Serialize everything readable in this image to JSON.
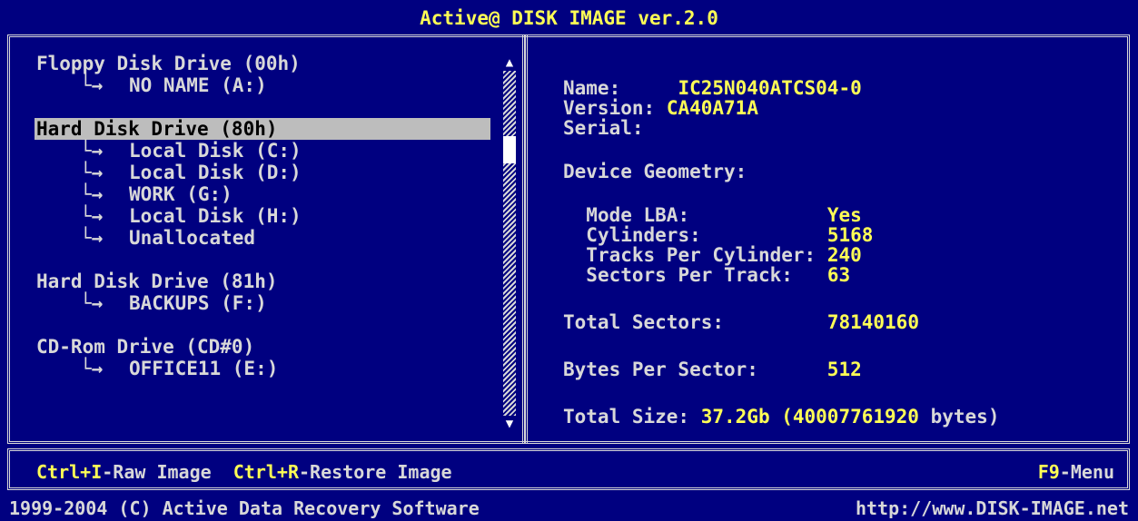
{
  "title": "Active@ DISK IMAGE ver.2.0",
  "tree": {
    "floppy": {
      "label": "Floppy Disk Drive (00h)",
      "children": [
        "NO NAME (A:)"
      ]
    },
    "hdd0": {
      "label": "Hard Disk Drive (80h)",
      "children": [
        "Local Disk (C:)",
        "Local Disk (D:)",
        "WORK (G:)",
        "Local Disk (H:)",
        "Unallocated"
      ]
    },
    "hdd1": {
      "label": "Hard Disk Drive (81h)",
      "children": [
        "BACKUPS (F:)"
      ]
    },
    "cdrom": {
      "label": "CD-Rom Drive (CD#0)",
      "children": [
        "OFFICE11 (E:)"
      ]
    }
  },
  "details": {
    "name_label": "Name:",
    "name_value": "IC25N040ATCS04-0",
    "version_label": "Version:",
    "version_value": "CA40A71A",
    "serial_label": "Serial:",
    "geometry_label": "Device Geometry:",
    "mode_label": "Mode LBA:",
    "mode_value": "Yes",
    "cyl_label": "Cylinders:",
    "cyl_value": "5168",
    "tpc_label": "Tracks Per Cylinder:",
    "tpc_value": "240",
    "spt_label": "Sectors Per Track:",
    "spt_value": "63",
    "total_sectors_label": "Total Sectors:",
    "total_sectors_value": "78140160",
    "bps_label": "Bytes Per Sector:",
    "bps_value": "512",
    "total_size_label": "Total Size:",
    "total_size_value": "37.2Gb (40007761920",
    "total_size_suffix": "bytes)"
  },
  "hotkeys": {
    "raw_key": "Ctrl+I",
    "raw_label": "-Raw Image",
    "restore_key": "Ctrl+R",
    "restore_label": "-Restore Image",
    "menu_key": "F9",
    "menu_label": "-Menu"
  },
  "footer": {
    "copyright": "1999-2004 (C) Active Data Recovery Software",
    "url": "http://www.DISK-IMAGE.net"
  },
  "colors": {
    "background": "#000080",
    "accent": "#ffff55",
    "text": "#d8d8d8",
    "selection": "#bdbdbd"
  },
  "arrow_glyph": "└→"
}
